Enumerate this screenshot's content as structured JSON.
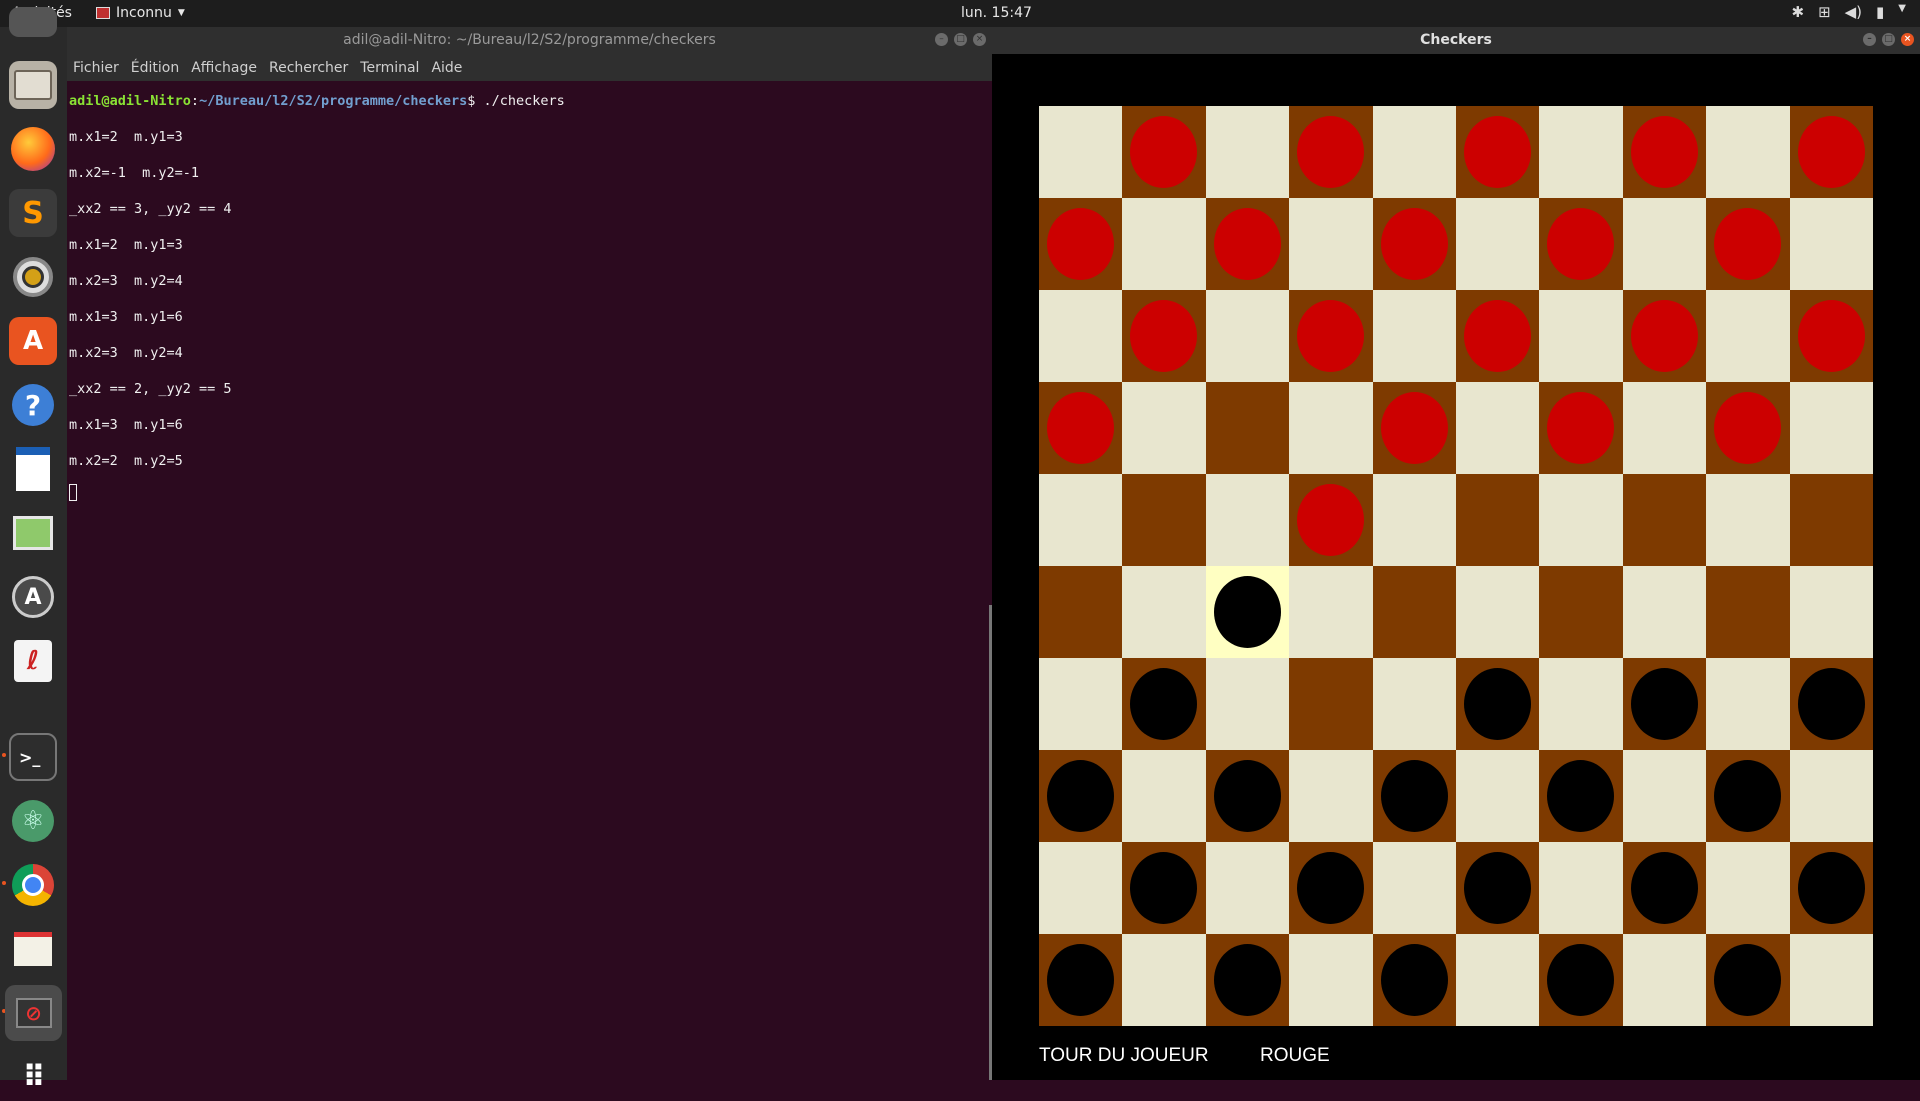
{
  "topbar": {
    "activities": "Activités",
    "app_menu": "Inconnu",
    "clock": "lun. 15:47",
    "tray_icons": [
      "bluetooth-icon",
      "network-icon",
      "volume-icon",
      "battery-icon",
      "chevron-down-icon"
    ]
  },
  "dock": {
    "items": [
      "files-icon",
      "firefox-icon",
      "sublime-text-icon",
      "rhythmbox-icon",
      "software-center-icon",
      "help-icon",
      "writer-icon",
      "image-viewer-icon",
      "software-updater-icon",
      "pdf-viewer-icon",
      "terminal-icon",
      "atom-icon",
      "chrome-icon",
      "text-editor-icon",
      "checkers-app-icon",
      "show-applications-icon"
    ]
  },
  "terminal": {
    "title": "adil@adil-Nitro: ~/Bureau/l2/S2/programme/checkers",
    "menu": [
      "Fichier",
      "Édition",
      "Affichage",
      "Rechercher",
      "Terminal",
      "Aide"
    ],
    "prompt_user": "adil@adil-Nitro",
    "prompt_sep": ":",
    "prompt_path": "~/Bureau/l2/S2/programme/checkers",
    "prompt_cmd": "$ ./checkers",
    "output": [
      "m.x1=2  m.y1=3",
      "m.x2=-1  m.y2=-1",
      "_xx2 == 3, _yy2 == 4",
      "m.x1=2  m.y1=3",
      "m.x2=3  m.y2=4",
      "m.x1=3  m.y1=6",
      "m.x2=3  m.y2=4",
      "_xx2 == 2, _yy2 == 5",
      "m.x1=3  m.y1=6",
      "m.x2=2  m.y2=5"
    ]
  },
  "checkers": {
    "title": "Checkers",
    "status_label": "TOUR DU JOUEUR",
    "status_value": "ROUGE",
    "colors": {
      "light": "#e8e6cf",
      "dark": "#7e3a00",
      "highlight": "#ffffc2",
      "red": "#cc0000",
      "black": "#000000"
    },
    "board": [
      ".R.R.R.R.R",
      "R.R.R.R.R.",
      ".R.R.R.R.R",
      "R...R.R.R.",
      "...R......",
      "..B.......",
      ".B...B.B.B",
      "B.B.B.B.B.",
      ".B.B.B.B.B",
      "B.B.B.B.B."
    ],
    "dark_cells": [
      [
        0,
        1
      ],
      [
        0,
        3
      ],
      [
        0,
        5
      ],
      [
        0,
        7
      ],
      [
        0,
        9
      ],
      [
        1,
        0
      ],
      [
        1,
        2
      ],
      [
        1,
        4
      ],
      [
        1,
        6
      ],
      [
        1,
        8
      ],
      [
        2,
        1
      ],
      [
        2,
        3
      ],
      [
        2,
        5
      ],
      [
        2,
        7
      ],
      [
        2,
        9
      ],
      [
        3,
        0
      ],
      [
        3,
        2
      ],
      [
        3,
        4
      ],
      [
        3,
        6
      ],
      [
        3,
        8
      ],
      [
        4,
        1
      ],
      [
        4,
        3
      ],
      [
        4,
        5
      ],
      [
        4,
        7
      ],
      [
        4,
        9
      ],
      [
        5,
        0
      ],
      [
        5,
        4
      ],
      [
        5,
        6
      ],
      [
        5,
        8
      ],
      [
        6,
        1
      ],
      [
        6,
        3
      ],
      [
        6,
        5
      ],
      [
        6,
        7
      ],
      [
        6,
        9
      ],
      [
        7,
        0
      ],
      [
        7,
        2
      ],
      [
        7,
        4
      ],
      [
        7,
        6
      ],
      [
        7,
        8
      ],
      [
        8,
        1
      ],
      [
        8,
        3
      ],
      [
        8,
        5
      ],
      [
        8,
        7
      ],
      [
        8,
        9
      ],
      [
        9,
        0
      ],
      [
        9,
        2
      ],
      [
        9,
        4
      ],
      [
        9,
        6
      ],
      [
        9,
        8
      ]
    ],
    "highlight_cell": [
      5,
      2
    ]
  }
}
